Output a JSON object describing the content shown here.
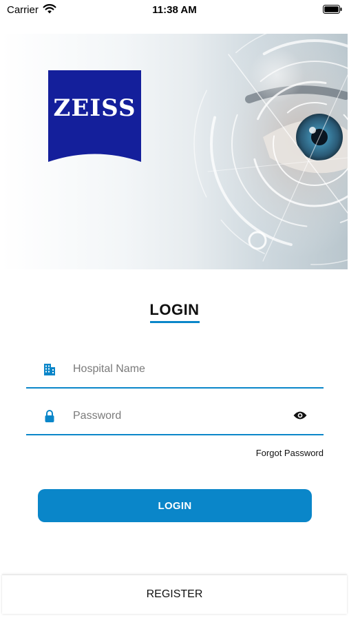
{
  "status_bar": {
    "carrier": "Carrier",
    "time": "11:38 AM",
    "icons": [
      "wifi-icon",
      "battery-icon"
    ]
  },
  "hero": {
    "logo_text": "ZEISS",
    "logo_color": "#141f9b",
    "description_icon": "eye-illustration"
  },
  "login": {
    "title": "LOGIN",
    "accent_color": "#0a86c9",
    "hospital": {
      "placeholder": "Hospital Name",
      "value": "",
      "icon": "building-icon"
    },
    "password": {
      "placeholder": "Password",
      "value": "",
      "icon": "lock-icon",
      "toggle_icon": "eye-icon"
    },
    "forgot_label": "Forgot Password",
    "button_label": "LOGIN"
  },
  "footer": {
    "register_label": "REGISTER"
  }
}
